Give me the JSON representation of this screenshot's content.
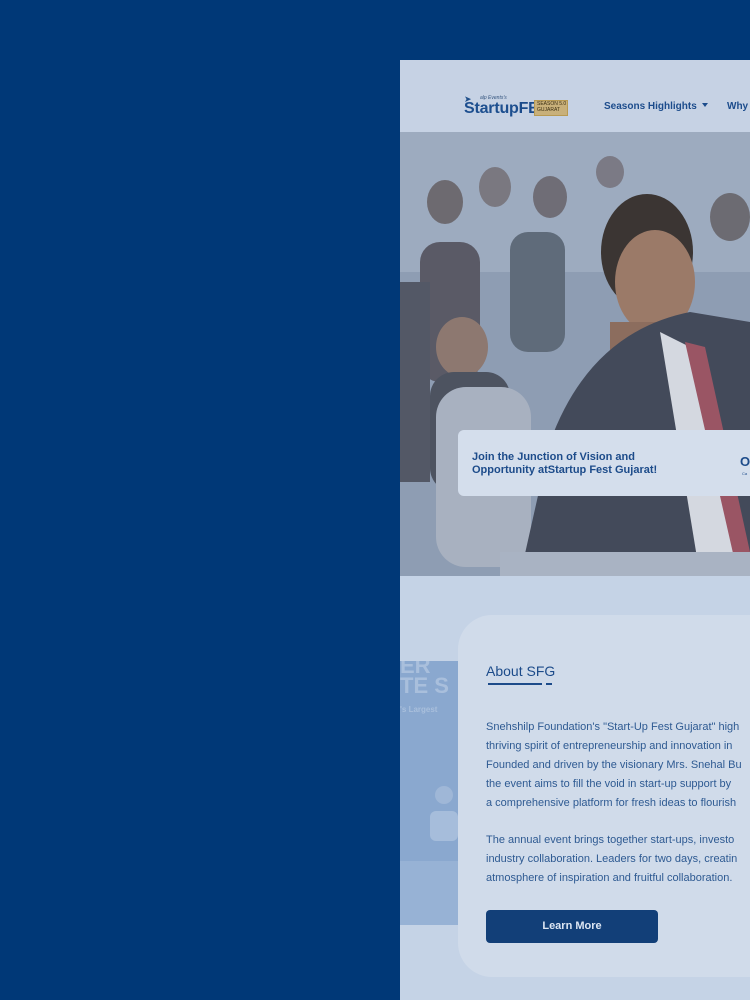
{
  "nav": {
    "logo": {
      "tag": "alp Events's",
      "word_startup": "Startup",
      "word_fest": "FEST",
      "edition": "SEASON 5.0",
      "region": "GUJARAT"
    },
    "menu": [
      {
        "label": "Seasons Highlights",
        "has_dropdown": true
      },
      {
        "label": "Why A",
        "has_dropdown": false
      }
    ]
  },
  "hero": {
    "card_text": "Join the Junction of Vision and Opportunity atStartup Fest Gujarat!",
    "card_action": "O",
    "card_subtext": "Ca"
  },
  "gallery": {
    "ghost_line1": "ER",
    "ghost_line2": "TE S",
    "ghost_line3": "'s Largest"
  },
  "about": {
    "heading": "About SFG",
    "paragraph1_lines": [
      "Snehshilp Foundation's \"Start-Up Fest Gujarat\" high",
      "thriving spirit of entrepreneurship and innovation in",
      "Founded and driven by the visionary Mrs. Snehal Bu",
      "the event aims to fill the void in start-up support by",
      "a comprehensive platform for fresh ideas to flourish"
    ],
    "paragraph2_lines": [
      "The annual event brings together start-ups, investo",
      "industry collaboration. Leaders for two days, creatin",
      "atmosphere of inspiration and fruitful collaboration."
    ],
    "learn_more_label": "Learn More"
  },
  "colors": {
    "overlay_blue": "#003877",
    "brand_blue": "#1c4b8a",
    "button_blue": "#123f78",
    "logo_gold": "#c8b07a"
  }
}
